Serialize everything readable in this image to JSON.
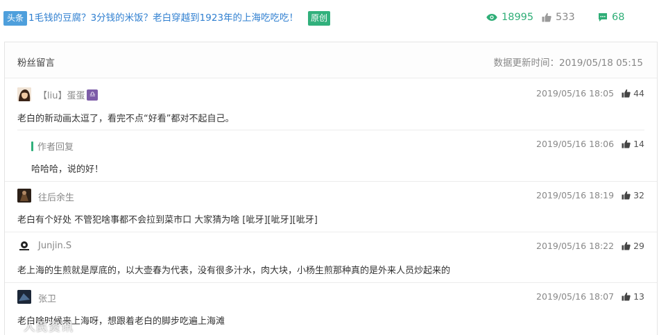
{
  "article": {
    "tag": "头条",
    "title": "1毛钱的豆腐？3分钱的米饭？老白穿越到1923年的上海吃吃吃！",
    "original_tag": "原创",
    "views": "18995",
    "likes": "533",
    "comments": "68"
  },
  "panel": {
    "title": "粉丝留言",
    "update_label": "数据更新时间：",
    "update_time": "2019/05/18 05:15"
  },
  "comments": [
    {
      "user": "【liu】蛋蛋",
      "badge": "♎",
      "date": "2019/05/16 18:05",
      "likes": "44",
      "text": "老白的新动画太逗了，看完不点“好看”都对不起自己。",
      "reply": {
        "label": "作者回复",
        "date": "2019/05/16 18:06",
        "likes": "14",
        "text": "哈哈哈，说的好！"
      }
    },
    {
      "user": "往后余生",
      "date": "2019/05/16 18:19",
      "likes": "32",
      "text": "老白有个好处 不管犯啥事都不会拉到菜市口 大家猜为啥 [呲牙][呲牙][呲牙]"
    },
    {
      "user": "Junjin.S",
      "date": "2019/05/16 18:22",
      "likes": "29",
      "text": "老上海的生煎就是厚底的，以大壶春为代表，没有很多汁水，肉大块，小杨生煎那种真的是外来人员炒起来的"
    },
    {
      "user": "张卫",
      "date": "2019/05/16 18:07",
      "likes": "13",
      "text": "老白啥时候来上海呀，想跟着老白的脚步吃遍上海滩"
    }
  ],
  "watermark": "人民资讯",
  "colors": {
    "link_blue": "#2f7fd0",
    "green": "#2fae77",
    "tag_blue": "#4e9fdc"
  }
}
